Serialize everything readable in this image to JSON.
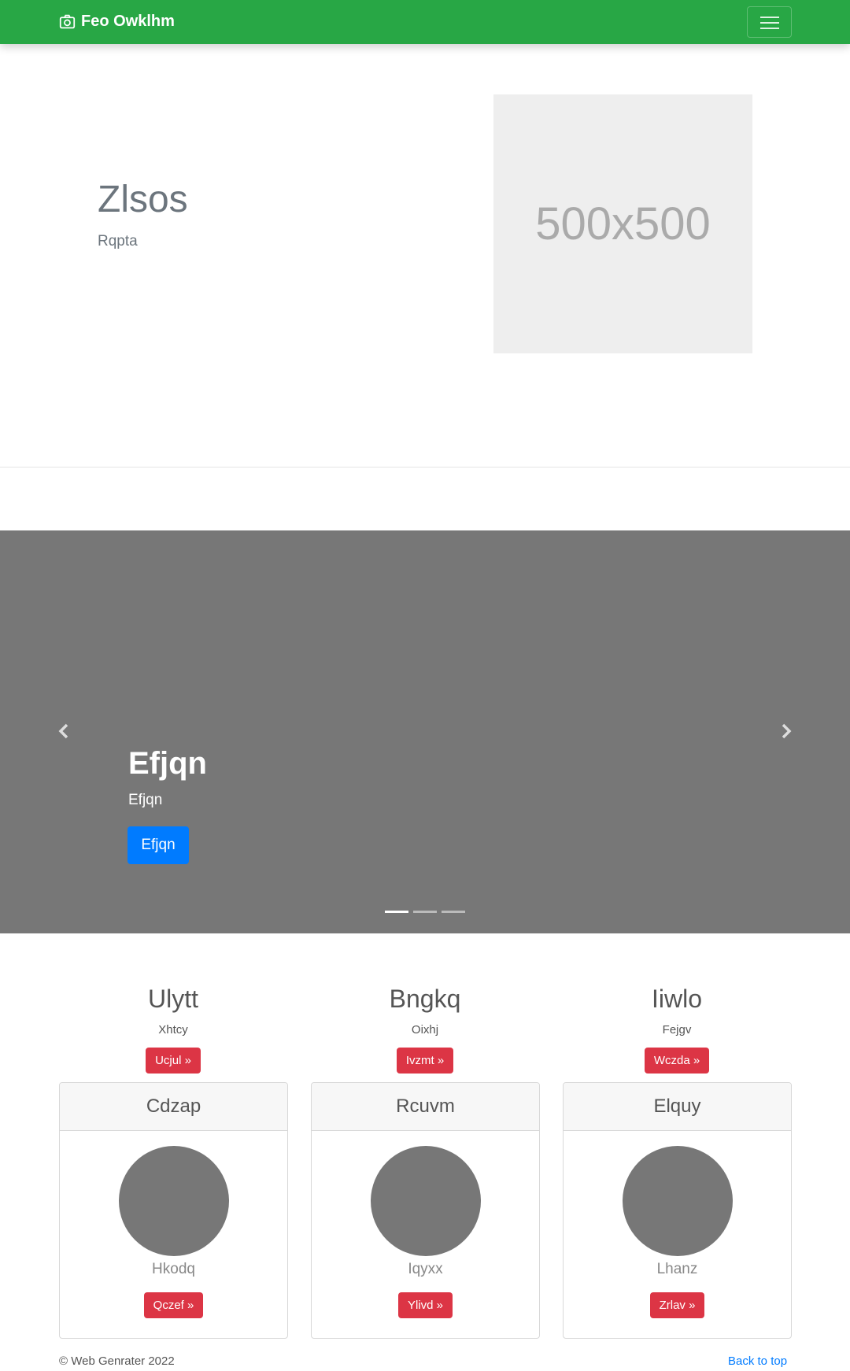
{
  "navbar": {
    "brand": "Feo Owklhm",
    "brand_icon": "camera-icon",
    "toggler_icon": "hamburger-icon"
  },
  "hero": {
    "title": "Zlsos",
    "subtitle": "Rqpta",
    "placeholder_text": "500x500"
  },
  "carousel": {
    "title": "Efjqn",
    "text": "Efjqn",
    "button": "Efjqn",
    "prev_icon": "chevron-left-icon",
    "next_icon": "chevron-right-icon",
    "slides": 3,
    "active_slide": 1
  },
  "columns": [
    {
      "title": "Ulytt",
      "text": "Xhtcy",
      "button": "Ucjul »"
    },
    {
      "title": "Bngkq",
      "text": "Oixhj",
      "button": "Ivzmt »"
    },
    {
      "title": "Iiwlo",
      "text": "Fejgv",
      "button": "Wczda »"
    }
  ],
  "cards": [
    {
      "header": "Cdzap",
      "text": "Hkodq",
      "button": "Qczef »"
    },
    {
      "header": "Rcuvm",
      "text": "Iqyxx",
      "button": "Ylivd »"
    },
    {
      "header": "Elquy",
      "text": "Lhanz",
      "button": "Zrlav »"
    }
  ],
  "footer": {
    "copyright": "© Web Genrater 2022",
    "back_to_top": "Back to top"
  },
  "colors": {
    "navbar": "#28a745",
    "primary": "#007bff",
    "danger": "#dc3545",
    "carousel_bg": "#777777"
  }
}
